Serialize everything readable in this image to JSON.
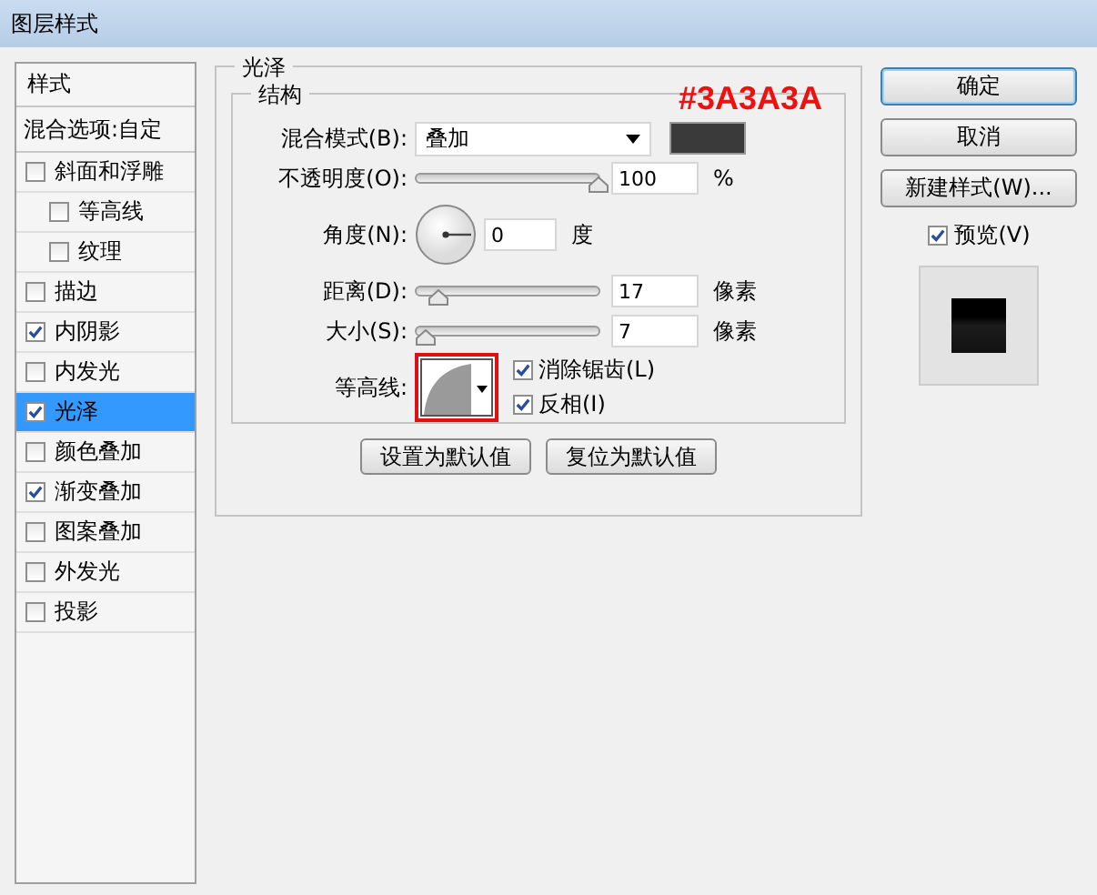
{
  "window": {
    "title": "图层样式"
  },
  "sidebar": {
    "header": "样式",
    "blend_options": "混合选项:自定",
    "items": [
      {
        "label": "斜面和浮雕",
        "checked": false,
        "selected": false,
        "children": [
          {
            "label": "等高线",
            "checked": false,
            "selected": false
          },
          {
            "label": "纹理",
            "checked": false,
            "selected": false
          }
        ]
      },
      {
        "label": "描边",
        "checked": false,
        "selected": false
      },
      {
        "label": "内阴影",
        "checked": true,
        "selected": false
      },
      {
        "label": "内发光",
        "checked": false,
        "selected": false
      },
      {
        "label": "光泽",
        "checked": true,
        "selected": true
      },
      {
        "label": "颜色叠加",
        "checked": false,
        "selected": false
      },
      {
        "label": "渐变叠加",
        "checked": true,
        "selected": false
      },
      {
        "label": "图案叠加",
        "checked": false,
        "selected": false
      },
      {
        "label": "外发光",
        "checked": false,
        "selected": false
      },
      {
        "label": "投影",
        "checked": false,
        "selected": false
      }
    ]
  },
  "panel": {
    "title": "光泽",
    "group_title": "结构",
    "annotation": "#3A3A3A",
    "blend_mode": {
      "label": "混合模式(B):",
      "value": "叠加",
      "color": "#3a3a3a"
    },
    "opacity": {
      "label": "不透明度(O):",
      "level": 1.0,
      "value": "100",
      "unit": "%"
    },
    "angle": {
      "label": "角度(N):",
      "value": "0",
      "unit": "度"
    },
    "distance": {
      "label": "距离(D):",
      "level": 0.12,
      "value": "17",
      "unit": "像素"
    },
    "size": {
      "label": "大小(S):",
      "level": 0.05,
      "value": "7",
      "unit": "像素"
    },
    "contour": {
      "label": "等高线:",
      "highlighted": true
    },
    "options": [
      {
        "label": "消除锯齿(L)",
        "checked": true
      },
      {
        "label": "反相(I)",
        "checked": true
      }
    ],
    "buttons": [
      "设置为默认值",
      "复位为默认值"
    ]
  },
  "actions": {
    "buttons": [
      {
        "label": "确定",
        "default": true
      },
      {
        "label": "取消",
        "default": false
      },
      {
        "label": "新建样式(W)...",
        "default": false
      }
    ],
    "preview": {
      "label": "预览(V)",
      "checked": true
    }
  }
}
